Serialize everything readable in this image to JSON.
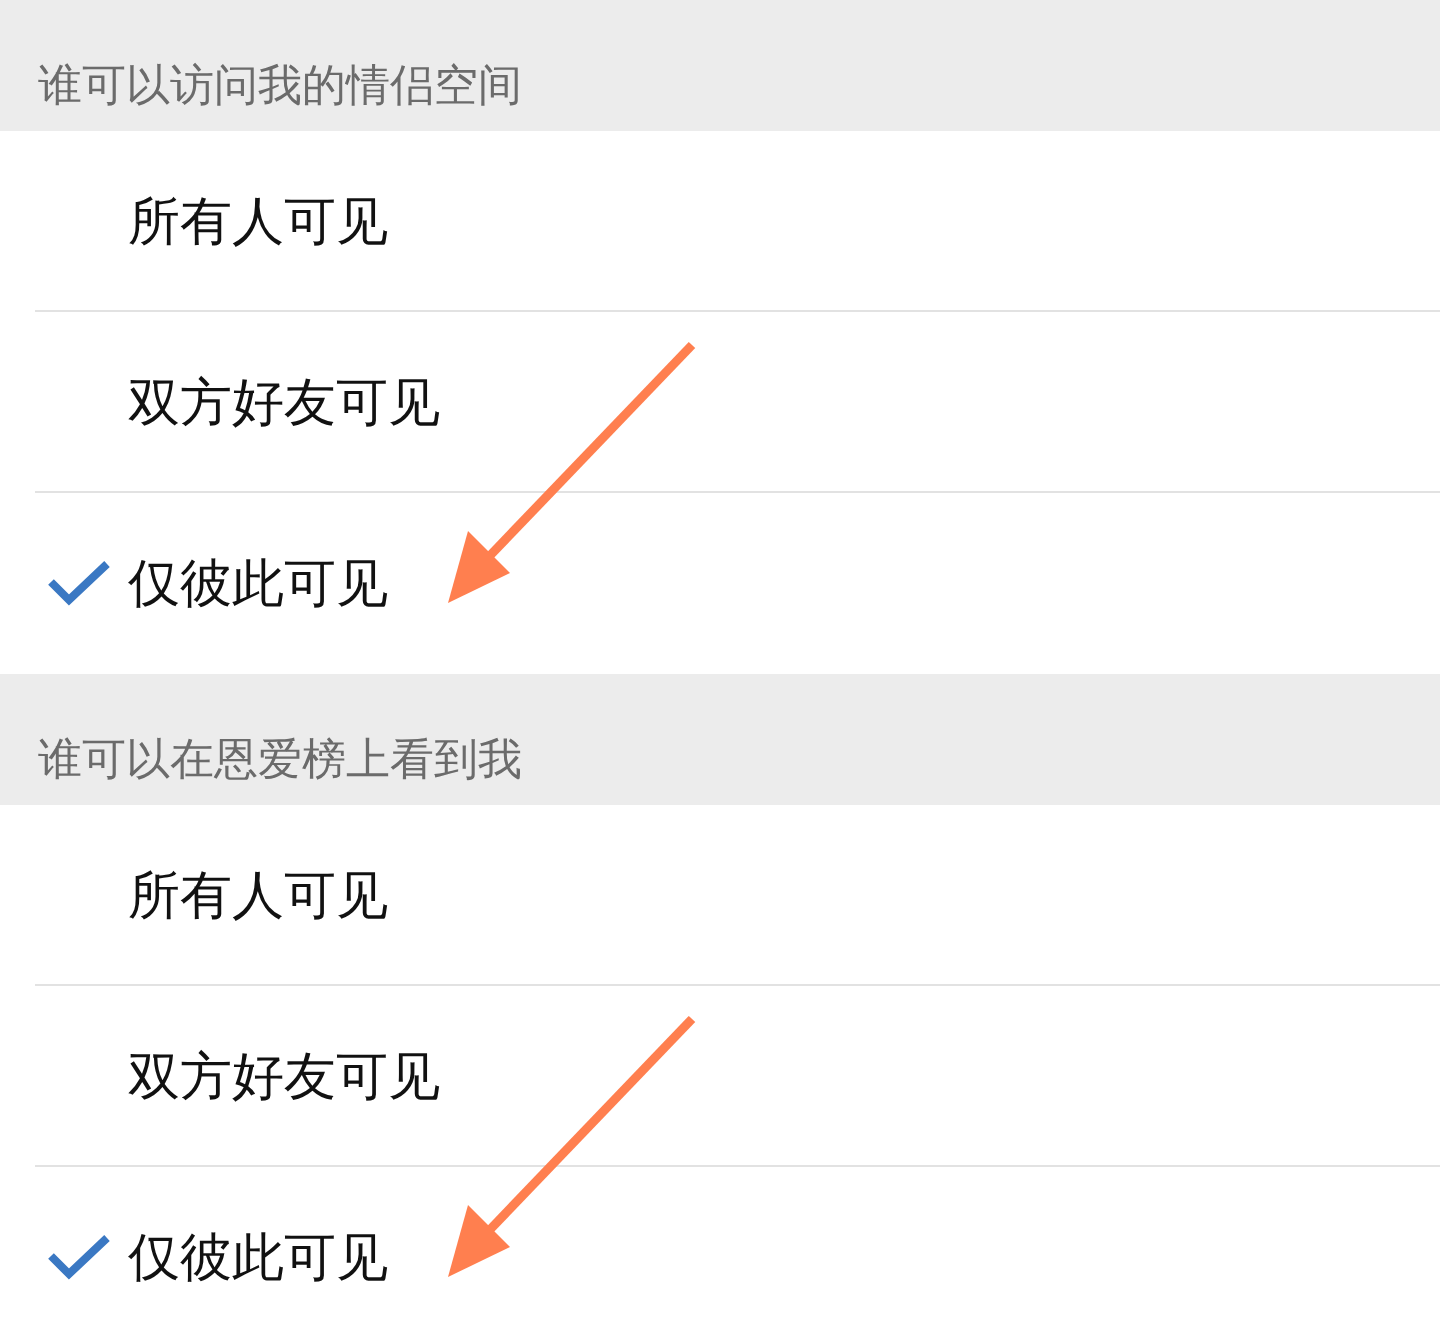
{
  "sections": [
    {
      "header": "谁可以访问我的情侣空间",
      "options": [
        {
          "label": "所有人可见",
          "selected": false,
          "annotated": false
        },
        {
          "label": "双方好友可见",
          "selected": false,
          "annotated": false
        },
        {
          "label": "仅彼此可见",
          "selected": true,
          "annotated": true
        }
      ]
    },
    {
      "header": "谁可以在恩爱榜上看到我",
      "options": [
        {
          "label": "所有人可见",
          "selected": false,
          "annotated": false
        },
        {
          "label": "双方好友可见",
          "selected": false,
          "annotated": false
        },
        {
          "label": "仅彼此可见",
          "selected": true,
          "annotated": true
        }
      ]
    }
  ]
}
